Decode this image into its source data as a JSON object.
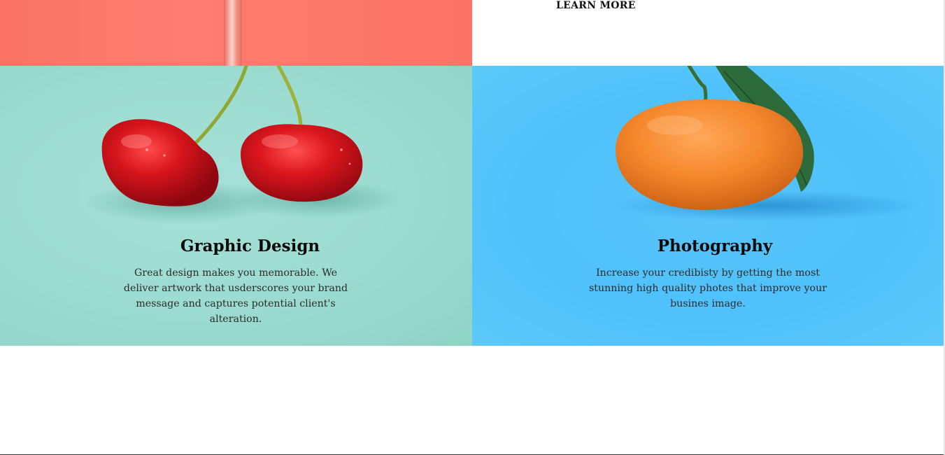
{
  "top": {
    "learn_more": "LEARN MORE"
  },
  "services": [
    {
      "title": "Graphic Design",
      "description": "Great design makes you memorable. We deliver artwork that usderscores your brand message and captures potential client's alteration."
    },
    {
      "title": "Photography",
      "description": "Increase your credibisty by getting the most stunning high quality photes that improve your busines image."
    }
  ],
  "colors": {
    "coral": "#fd7769",
    "mint": "#9ddcd1",
    "sky": "#4fc1fb",
    "cherry": "#d3141c",
    "orange": "#f5872c"
  }
}
